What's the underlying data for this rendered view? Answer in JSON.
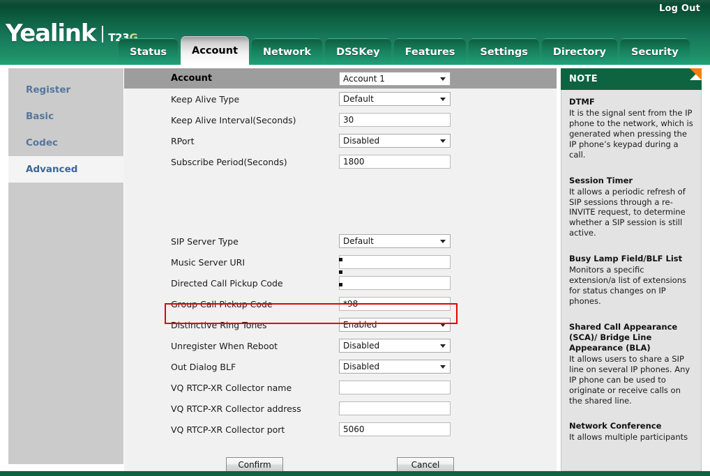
{
  "header": {
    "logout_label": "Log Out",
    "brand_name": "Yealink",
    "model_prefix": "T23",
    "model_suffix": "G",
    "accent_green": "#0e6340",
    "accent_orange": "#f08010"
  },
  "tabs": [
    {
      "label": "Status",
      "active": false
    },
    {
      "label": "Account",
      "active": true
    },
    {
      "label": "Network",
      "active": false
    },
    {
      "label": "DSSKey",
      "active": false
    },
    {
      "label": "Features",
      "active": false
    },
    {
      "label": "Settings",
      "active": false
    },
    {
      "label": "Directory",
      "active": false
    },
    {
      "label": "Security",
      "active": false
    }
  ],
  "sidebar": {
    "items": [
      {
        "label": "Register",
        "active": false
      },
      {
        "label": "Basic",
        "active": false
      },
      {
        "label": "Codec",
        "active": false
      },
      {
        "label": "Advanced",
        "active": true
      }
    ]
  },
  "form": {
    "banner": {
      "label": "Account",
      "value": "Account 1",
      "type": "select"
    },
    "rows_top": [
      {
        "label": "Keep Alive Type",
        "value": "Default",
        "type": "select"
      },
      {
        "label": "Keep Alive Interval(Seconds)",
        "value": "30",
        "type": "text"
      },
      {
        "label": "RPort",
        "value": "Disabled",
        "type": "select"
      },
      {
        "label": "Subscribe Period(Seconds)",
        "value": "1800",
        "type": "text"
      }
    ],
    "ellipsis_dots": 3,
    "rows_bottom": [
      {
        "label": "SIP Server Type",
        "value": "Default",
        "type": "select",
        "highlighted": false
      },
      {
        "label": "Music Server URI",
        "value": "",
        "type": "text",
        "highlighted": false
      },
      {
        "label": "Directed Call Pickup Code",
        "value": "",
        "type": "text",
        "highlighted": false
      },
      {
        "label": "Group Call Pickup Code",
        "value": "*98",
        "type": "text",
        "highlighted": true
      },
      {
        "label": "Distinctive Ring Tones",
        "value": "Enabled",
        "type": "select",
        "highlighted": false
      },
      {
        "label": "Unregister When Reboot",
        "value": "Disabled",
        "type": "select",
        "highlighted": false
      },
      {
        "label": "Out Dialog BLF",
        "value": "Disabled",
        "type": "select",
        "highlighted": false
      },
      {
        "label": "VQ RTCP-XR Collector name",
        "value": "",
        "type": "text",
        "highlighted": false
      },
      {
        "label": "VQ RTCP-XR Collector address",
        "value": "",
        "type": "text",
        "highlighted": false
      },
      {
        "label": "VQ RTCP-XR Collector port",
        "value": "5060",
        "type": "text",
        "highlighted": false
      }
    ],
    "confirm_label": "Confirm",
    "cancel_label": "Cancel",
    "highlight_color": "#e50000"
  },
  "note": {
    "heading": "NOTE",
    "entries": [
      {
        "title": "DTMF",
        "text": "It is the signal sent from the IP phone to the network, which is generated when pressing the IP phone’s keypad during a call."
      },
      {
        "title": "Session Timer",
        "text": "It allows a periodic refresh of SIP sessions through a re-INVITE request, to determine whether a SIP session is still active."
      },
      {
        "title": "Busy Lamp Field/BLF List",
        "text": "Monitors a specific extension/a list of extensions for status changes on IP phones."
      },
      {
        "title": "Shared Call Appearance (SCA)/ Bridge Line Appearance (BLA)",
        "text": "It allows users to share a SIP line on several IP phones. Any IP phone can be used to originate or receive calls on the shared line."
      },
      {
        "title": "Network Conference",
        "text": "It allows multiple participants"
      }
    ]
  }
}
